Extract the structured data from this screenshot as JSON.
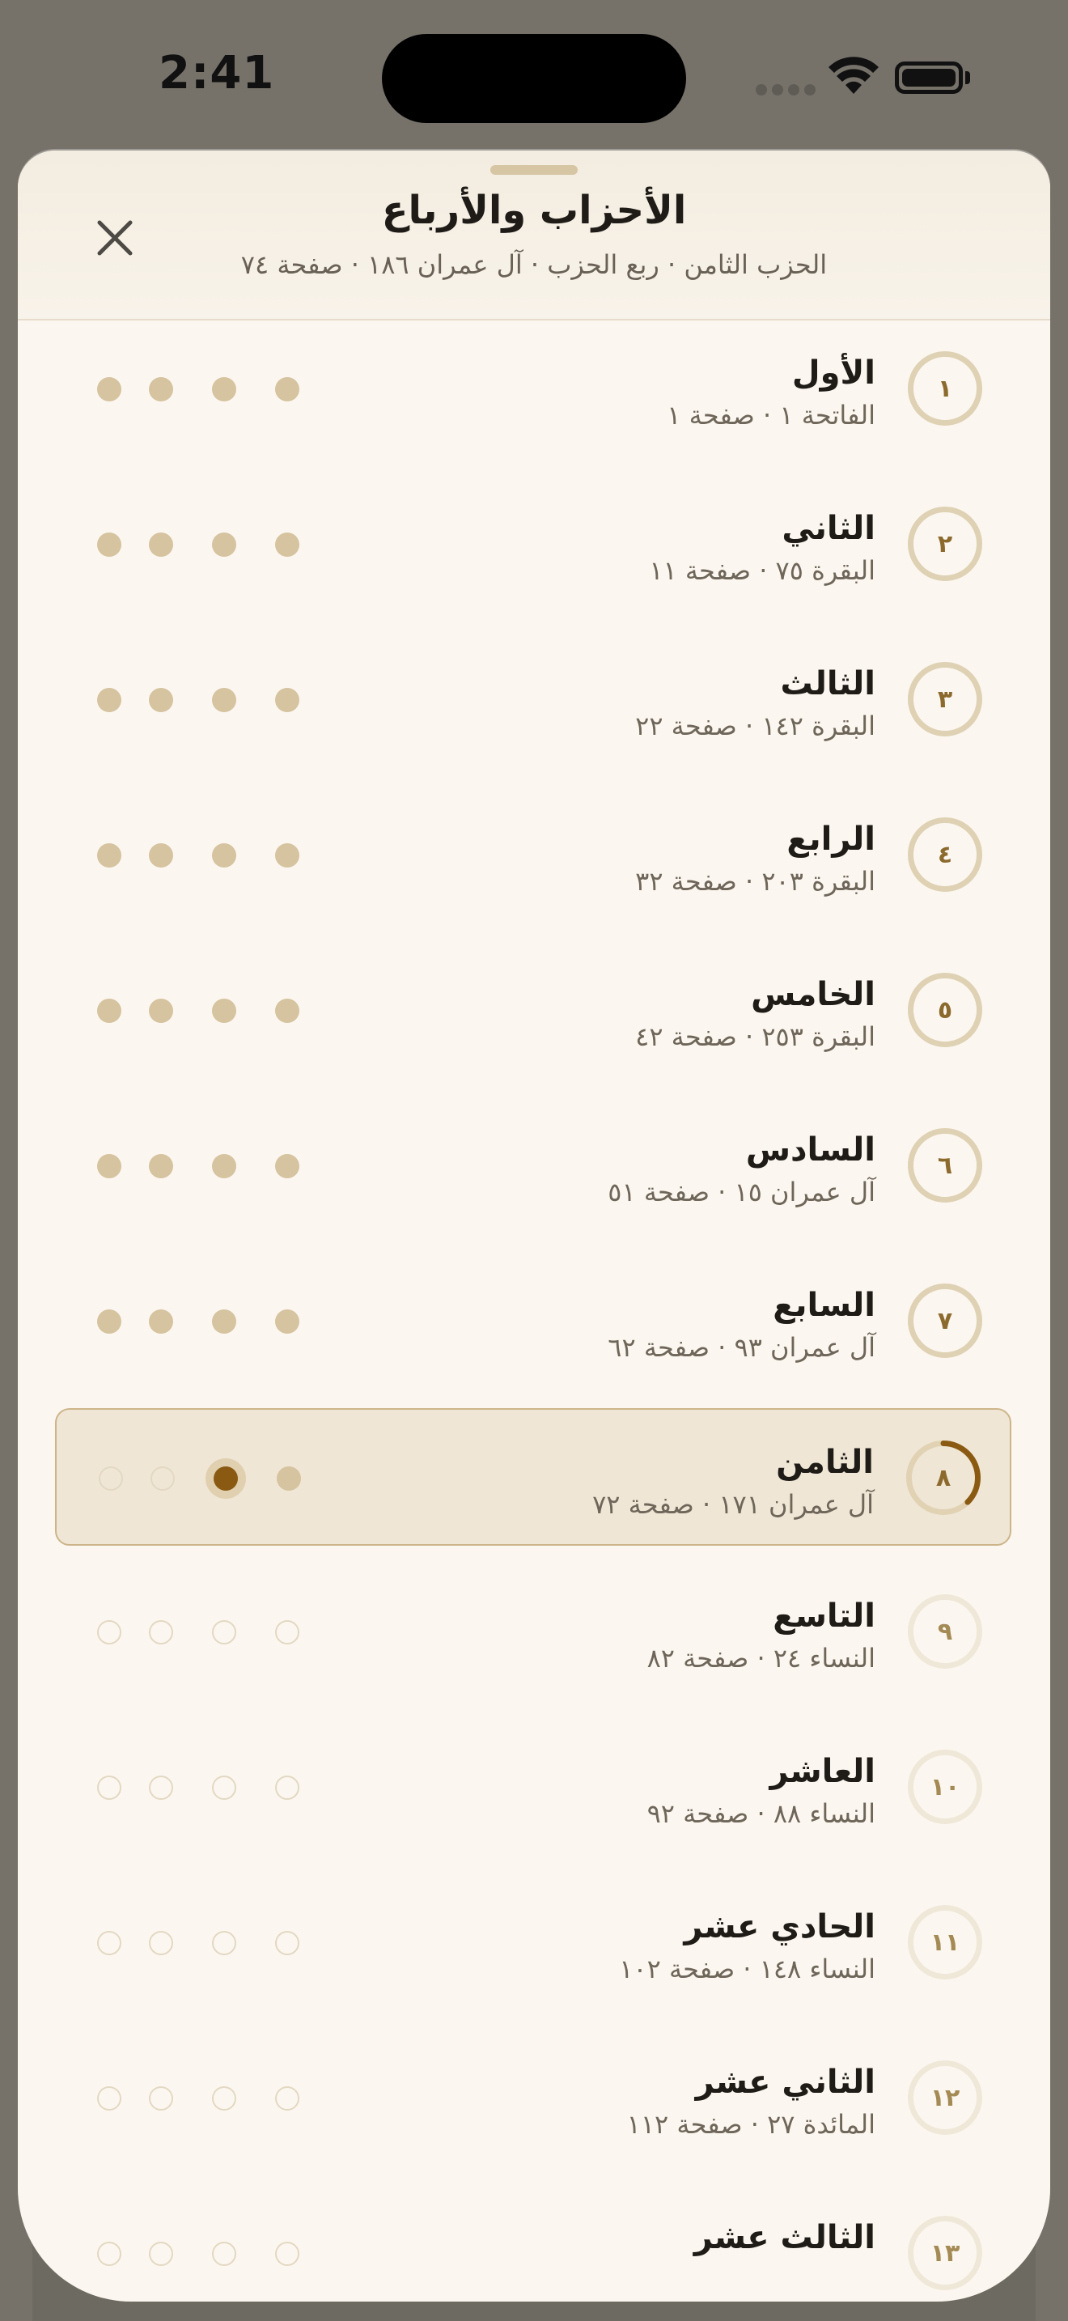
{
  "status_bar": {
    "time": "2:41"
  },
  "header": {
    "title": "الأحزاب والأرباع",
    "subtitle": "الحزب الثامن · ربع الحزب · آل عمران ١٨٦ · صفحة ٧٤"
  },
  "colors": {
    "accent": "#8a5a12",
    "completed_dot": "#d6c39f",
    "current_row_bg": "#efe6d6",
    "sheet_bg": "#fbf7f0"
  },
  "current_hizb": 8,
  "current_quarter": 2,
  "hizbs": [
    {
      "number": "١",
      "name": "الأول",
      "detail": "الفاتحة ١ · صفحة ١",
      "quarters_completed": 4
    },
    {
      "number": "٢",
      "name": "الثاني",
      "detail": "البقرة ٧٥ · صفحة ١١",
      "quarters_completed": 4
    },
    {
      "number": "٣",
      "name": "الثالث",
      "detail": "البقرة ١٤٢ · صفحة ٢٢",
      "quarters_completed": 4
    },
    {
      "number": "٤",
      "name": "الرابع",
      "detail": "البقرة ٢٠٣ · صفحة ٣٢",
      "quarters_completed": 4
    },
    {
      "number": "٥",
      "name": "الخامس",
      "detail": "البقرة ٢٥٣ · صفحة ٤٢",
      "quarters_completed": 4
    },
    {
      "number": "٦",
      "name": "السادس",
      "detail": "آل عمران ١٥ · صفحة ٥١",
      "quarters_completed": 4
    },
    {
      "number": "٧",
      "name": "السابع",
      "detail": "آل عمران ٩٣ · صفحة ٦٢",
      "quarters_completed": 4
    },
    {
      "number": "٨",
      "name": "الثامن",
      "detail": "آل عمران ١٧١ · صفحة ٧٢",
      "quarters_completed": 1,
      "progress_fraction": 0.375
    },
    {
      "number": "٩",
      "name": "التاسع",
      "detail": "النساء ٢٤ · صفحة ٨٢",
      "quarters_completed": 0
    },
    {
      "number": "١٠",
      "name": "العاشر",
      "detail": "النساء ٨٨ · صفحة ٩٢",
      "quarters_completed": 0
    },
    {
      "number": "١١",
      "name": "الحادي عشر",
      "detail": "النساء ١٤٨ · صفحة ١٠٢",
      "quarters_completed": 0
    },
    {
      "number": "١٢",
      "name": "الثاني عشر",
      "detail": "المائدة ٢٧ · صفحة ١١٢",
      "quarters_completed": 0
    },
    {
      "number": "١٣",
      "name": "الثالث عشر",
      "detail": "",
      "quarters_completed": 0
    }
  ]
}
